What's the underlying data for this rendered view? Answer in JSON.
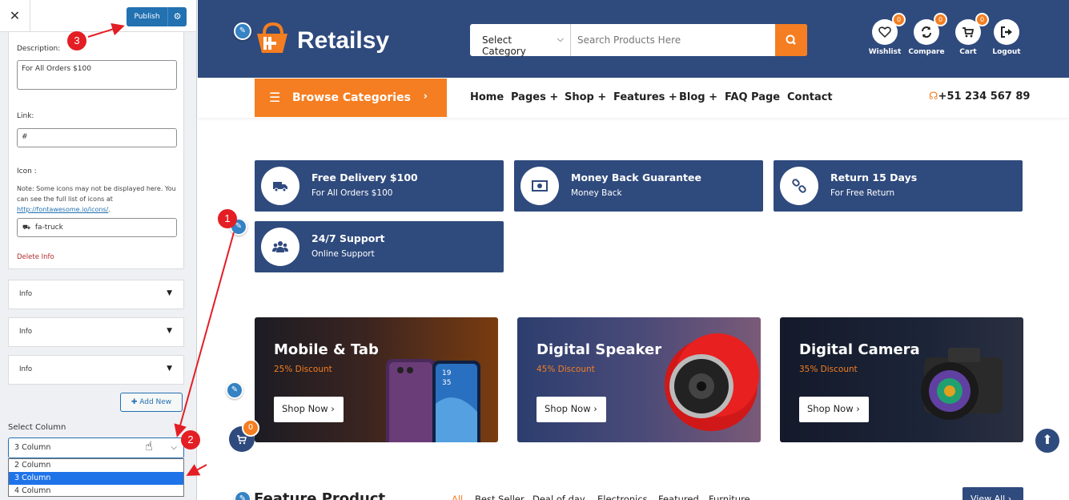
{
  "customizer": {
    "close_icon": "close-icon",
    "publish_label": "Publish",
    "gear_icon": "gear-icon",
    "description_label": "Description:",
    "description_value": "For All Orders $100",
    "link_label": "Link:",
    "link_value": "#",
    "icon_label": "Icon :",
    "icon_note": "Note: Some icons may not be displayed here. You can see the full list of icons at",
    "icon_note_link": "http://fontawesome.io/icons/",
    "icon_note_end": ".",
    "icon_value": "fa-truck",
    "delete_label": "Delete Info",
    "accordions": [
      "Info",
      "Info",
      "Info"
    ],
    "add_new_label": "Add New",
    "select_column_label": "Select Column",
    "select_column_value": "3 Column",
    "select_options": [
      "2 Column",
      "3 Column",
      "4 Column"
    ],
    "selected_option_index": 1
  },
  "site": {
    "brand": "Retailsy",
    "search": {
      "category": "Select Category",
      "placeholder": "Search Products Here"
    },
    "header_icons": [
      {
        "label": "Wishlist",
        "count": "0",
        "icon": "heart-icon"
      },
      {
        "label": "Compare",
        "count": "0",
        "icon": "sync-icon"
      },
      {
        "label": "Cart",
        "count": "0",
        "icon": "cart-icon"
      },
      {
        "label": "Logout",
        "icon": "logout-icon"
      }
    ],
    "browse_label": "Browse Categories",
    "nav": [
      "Home",
      "Pages +",
      "Shop +",
      "Features +",
      "Blog +",
      "FAQ Page",
      "Contact"
    ],
    "phone": "+51 234 567 89",
    "features": [
      {
        "title": "Free Delivery $100",
        "subtitle": "For All Orders $100",
        "icon": "truck-icon"
      },
      {
        "title": "Money Back Guarantee",
        "subtitle": "Money Back",
        "icon": "money-icon"
      },
      {
        "title": "Return 15 Days",
        "subtitle": "For Free Return",
        "icon": "link-icon"
      },
      {
        "title": "24/7 Support",
        "subtitle": "Online Support",
        "icon": "users-icon"
      }
    ],
    "banners": [
      {
        "title": "Mobile & Tab",
        "discount": "25% Discount",
        "button": "Shop Now ›"
      },
      {
        "title": "Digital Speaker",
        "discount": "45% Discount",
        "button": "Shop Now ›"
      },
      {
        "title": "Digital Camera",
        "discount": "35% Discount",
        "button": "Shop Now ›"
      }
    ],
    "cart_count": "0",
    "feature_product_title": "Feature Product",
    "product_tabs": [
      "All",
      "Best Seller",
      "Deal of day",
      "Electronics",
      "Featured",
      "Furniture"
    ],
    "view_all": "View All ›"
  },
  "annotations": {
    "markers": [
      "1",
      "2",
      "3"
    ],
    "color": "#e31e24"
  },
  "colors": {
    "navy": "#2f4a7d",
    "orange": "#f47e21",
    "wp_blue": "#2271b1"
  }
}
